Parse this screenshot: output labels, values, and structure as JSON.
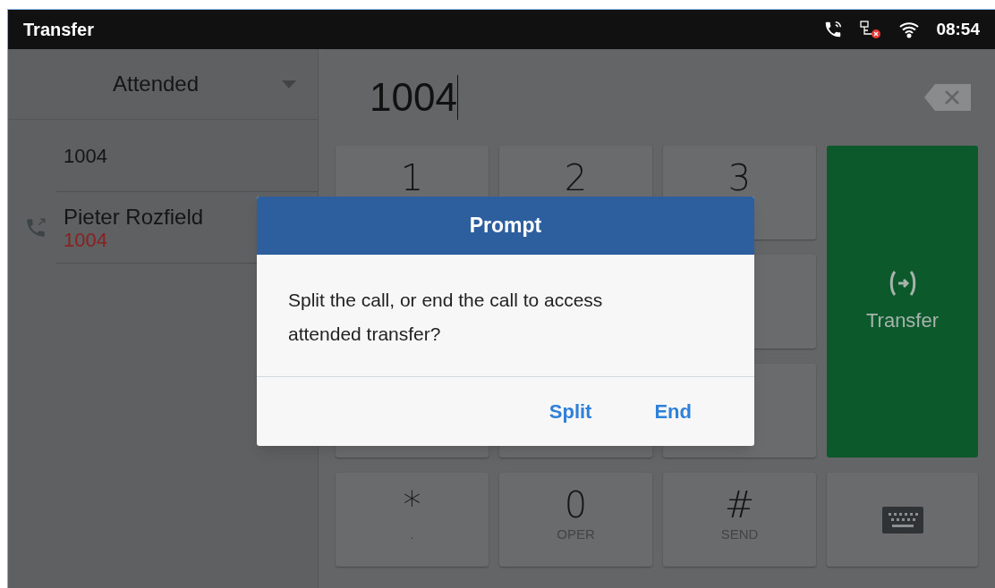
{
  "status_bar": {
    "title": "Transfer",
    "time": "08:54"
  },
  "transfer_mode": {
    "label": "Attended"
  },
  "contacts": [
    {
      "kind": "number",
      "name": "1004"
    },
    {
      "kind": "call",
      "name": "Pieter Rozfield",
      "number": "1004"
    }
  ],
  "dial_field": {
    "value": "1004"
  },
  "keypad": [
    {
      "kind": "digit",
      "digit": "1"
    },
    {
      "kind": "digit",
      "digit": "2"
    },
    {
      "kind": "digit",
      "digit": "3"
    },
    {
      "kind": "blank"
    },
    {
      "kind": "blank"
    },
    {
      "kind": "blank"
    },
    {
      "kind": "blank"
    },
    {
      "kind": "blank"
    },
    {
      "kind": "blank"
    },
    {
      "kind": "digit",
      "digit": "*",
      "letters": "."
    },
    {
      "kind": "digit",
      "digit": "0",
      "letters": "OPER"
    },
    {
      "kind": "digit",
      "digit": "#",
      "letters": "SEND"
    }
  ],
  "transfer_button": {
    "label": "Transfer"
  },
  "dialog": {
    "title": "Prompt",
    "message": "Split the call, or end the call to access attended transfer?",
    "buttons": [
      "Split",
      "End"
    ]
  }
}
